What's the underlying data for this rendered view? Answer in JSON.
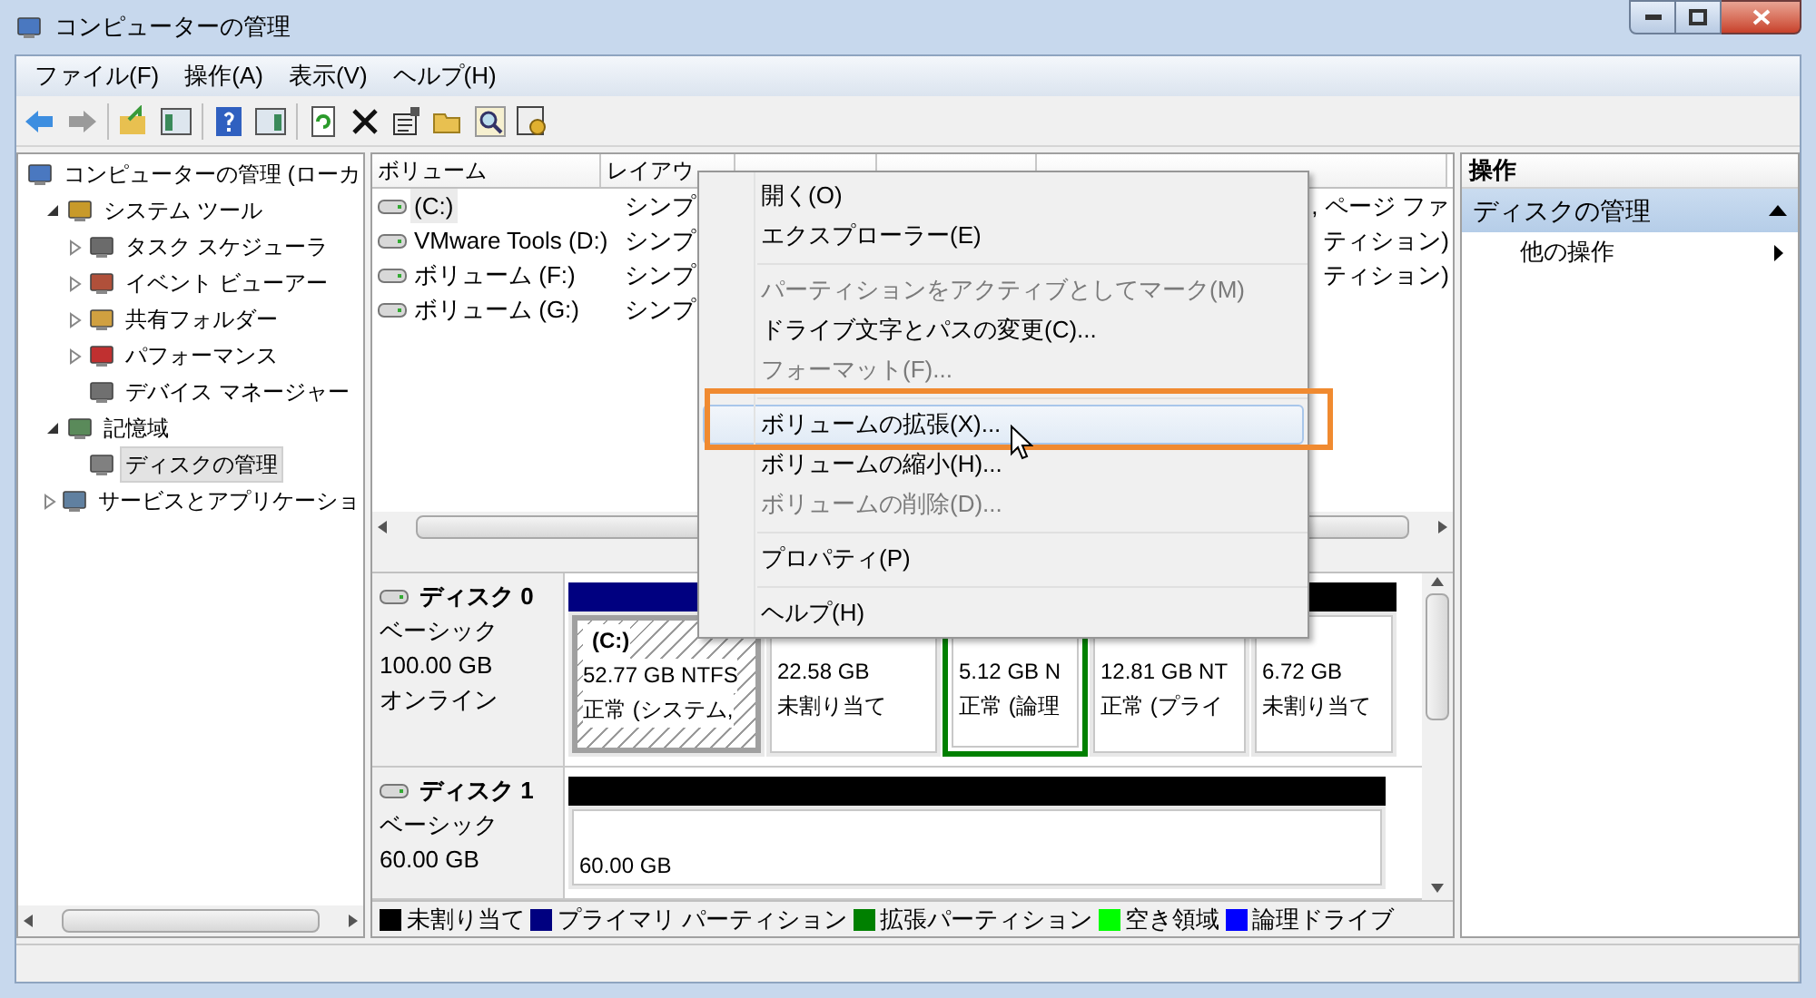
{
  "window": {
    "title": "コンピューターの管理"
  },
  "menu": [
    "ファイル(F)",
    "操作(A)",
    "表示(V)",
    "ヘルプ(H)"
  ],
  "tree": [
    {
      "label": "コンピューターの管理 (ローカ",
      "selected": false,
      "children": [
        {
          "label": "システム ツール",
          "expanded": true,
          "selected": false,
          "children": [
            {
              "label": "タスク スケジューラ",
              "expanded": false,
              "selected": false
            },
            {
              "label": "イベント ビューアー",
              "expanded": false,
              "selected": false
            },
            {
              "label": "共有フォルダー",
              "expanded": false,
              "selected": false
            },
            {
              "label": "パフォーマンス",
              "expanded": false,
              "selected": false
            },
            {
              "label": "デバイス マネージャー",
              "selected": false
            }
          ]
        },
        {
          "label": "記憶域",
          "expanded": true,
          "selected": false,
          "children": [
            {
              "label": "ディスクの管理",
              "selected": true
            }
          ]
        },
        {
          "label": "サービスとアプリケーショ",
          "expanded": false,
          "selected": false
        }
      ]
    }
  ],
  "volumes": {
    "columns": [
      "ボリューム",
      "レイアウ"
    ],
    "rows": [
      {
        "name": "(C:)",
        "layout": "シンプ",
        "column_5": ", ページ ファ",
        "selected": true
      },
      {
        "name": "VMware Tools (D:)",
        "layout": "シンプ",
        "column_5": "ティション)",
        "selected": false
      },
      {
        "name": "ボリューム (F:)",
        "layout": "シンプ",
        "column_5": "ティション)",
        "selected": false
      },
      {
        "name": "ボリューム (G:)",
        "layout": "シンプ",
        "column_5": "",
        "selected": false
      }
    ]
  },
  "disks": [
    {
      "name": "ディスク 0",
      "type": "ベーシック",
      "size": "100.00 GB",
      "status": "オンライン",
      "partitions": [
        {
          "kind": "primary",
          "name": "(C:)",
          "size": "52.77 GB NTFS",
          "status": "正常 (システム,",
          "selected": true
        },
        {
          "kind": "unallocated",
          "size": "22.58 GB",
          "status": "未割り当て",
          "selected": false
        },
        {
          "kind": "logical",
          "size": "5.12 GB N",
          "status": "正常 (論理",
          "selected": false
        },
        {
          "kind": "primary",
          "size": "12.81 GB NT",
          "status": "正常 (プライ",
          "selected": false
        },
        {
          "kind": "unallocated",
          "size": "6.72 GB",
          "status": "未割り当て",
          "selected": false
        }
      ]
    },
    {
      "name": "ディスク 1",
      "type": "ベーシック",
      "size": "60.00 GB",
      "partitions": [
        {
          "kind": "unallocated",
          "size": "60.00 GB",
          "selected": false
        }
      ]
    }
  ],
  "legend": [
    {
      "label": "未割り当て",
      "color": "#000000"
    },
    {
      "label": "プライマリ パーティション",
      "color": "#000080"
    },
    {
      "label": "拡張パーティション",
      "color": "#008000"
    },
    {
      "label": "空き領域",
      "color": "#00ff00"
    },
    {
      "label": "論理ドライブ",
      "color": "#0000ff"
    }
  ],
  "actions": {
    "title": "操作",
    "section": {
      "label": "ディスクの管理",
      "expanded": true
    },
    "items": [
      "他の操作"
    ]
  },
  "context_menu": [
    {
      "kind": "item",
      "label": "開く(O)",
      "disabled": false,
      "selected": false
    },
    {
      "kind": "item",
      "label": "エクスプローラー(E)",
      "disabled": false,
      "selected": false
    },
    {
      "kind": "separator"
    },
    {
      "kind": "item",
      "label": "パーティションをアクティブとしてマーク(M)",
      "disabled": true,
      "selected": false
    },
    {
      "kind": "item",
      "label": "ドライブ文字とパスの変更(C)...",
      "disabled": false,
      "selected": false
    },
    {
      "kind": "item",
      "label": "フォーマット(F)...",
      "disabled": true,
      "selected": false
    },
    {
      "kind": "separator"
    },
    {
      "kind": "item",
      "label": "ボリュームの拡張(X)...",
      "disabled": false,
      "selected": true
    },
    {
      "kind": "item",
      "label": "ボリュームの縮小(H)...",
      "disabled": false,
      "selected": false
    },
    {
      "kind": "item",
      "label": "ボリュームの削除(D)...",
      "disabled": true,
      "selected": false
    },
    {
      "kind": "separator"
    },
    {
      "kind": "item",
      "label": "プロパティ(P)",
      "disabled": false,
      "selected": false
    },
    {
      "kind": "separator"
    },
    {
      "kind": "item",
      "label": "ヘルプ(H)",
      "disabled": false,
      "selected": false
    }
  ]
}
